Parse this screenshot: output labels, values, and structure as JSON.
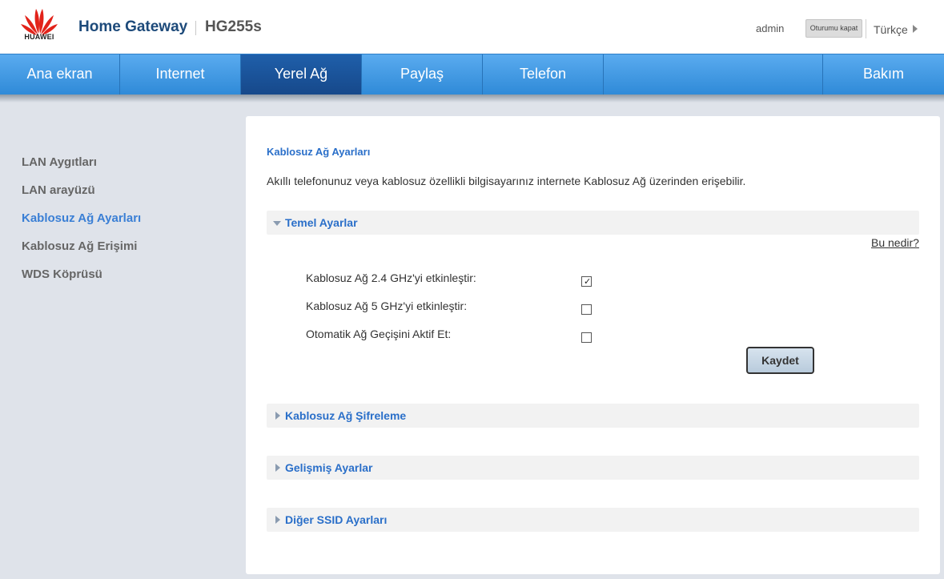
{
  "header": {
    "brand": "HUAWEI",
    "title": "Home Gateway",
    "model": "HG255s",
    "user": "admin",
    "logout_label": "Oturumu kapat",
    "language": "Türkçe"
  },
  "nav": {
    "items": [
      {
        "label": "Ana ekran"
      },
      {
        "label": "Internet"
      },
      {
        "label": "Yerel Ağ"
      },
      {
        "label": "Paylaş"
      },
      {
        "label": "Telefon"
      },
      {
        "label": "Bakım"
      }
    ],
    "active": "Yerel Ağ"
  },
  "sidebar": {
    "items": [
      {
        "label": "LAN Aygıtları"
      },
      {
        "label": "LAN arayüzü"
      },
      {
        "label": "Kablosuz Ağ Ayarları"
      },
      {
        "label": "Kablosuz Ağ Erişimi"
      },
      {
        "label": "WDS Köprüsü"
      }
    ],
    "active": "Kablosuz Ağ Ayarları"
  },
  "main": {
    "title": "Kablosuz Ağ Ayarları",
    "description": "Akıllı telefonunuz veya kablosuz özellikli bilgisayarınız internete Kablosuz Ağ üzerinden erişebilir.",
    "basic_section": {
      "label": "Temel Ayarlar",
      "help_link": "Bu nedir?",
      "options": [
        {
          "label": "Kablosuz Ağ 2.4 GHz'yi etkinleştir:",
          "checked": true
        },
        {
          "label": "Kablosuz Ağ 5 GHz'yi etkinleştir:",
          "checked": false
        },
        {
          "label": "Otomatik Ağ Geçişini Aktif Et:",
          "checked": false
        }
      ],
      "save_label": "Kaydet"
    },
    "collapsed_sections": [
      {
        "label": "Kablosuz Ağ Şifreleme"
      },
      {
        "label": "Gelişmiş Ayarlar"
      },
      {
        "label": "Diğer SSID Ayarları"
      }
    ]
  },
  "colors": {
    "nav_blue": "#3b97e3",
    "nav_active": "#1a5299",
    "accent_link": "#2a6fc9",
    "huawei_red": "#e2231a"
  }
}
